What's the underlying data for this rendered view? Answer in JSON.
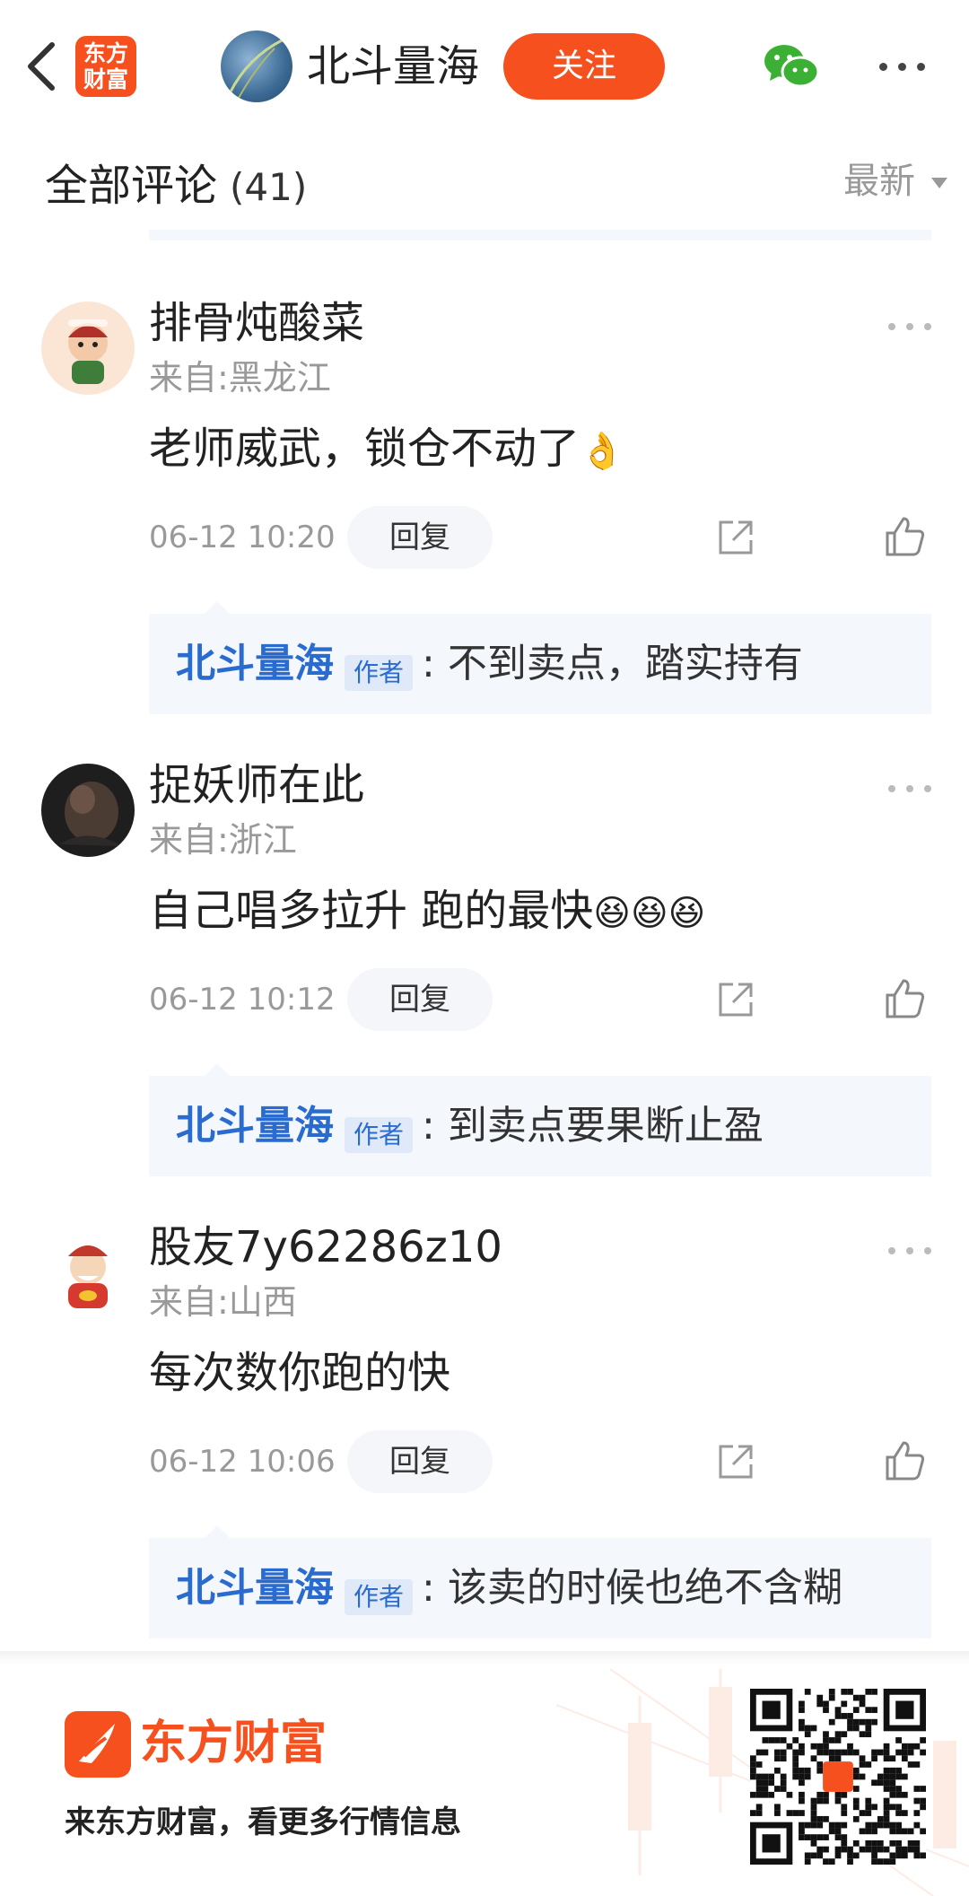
{
  "topbar": {
    "app_logo_text": "东方\n财富",
    "author_name": "北斗量海",
    "follow_label": "关注"
  },
  "section": {
    "title": "全部评论",
    "count": "(41)",
    "sort_label": "最新"
  },
  "comments": [
    {
      "name": "排骨炖酸菜",
      "location": "来自:黑龙江",
      "text": "老师威武，锁仓不动了",
      "emoji": "👌",
      "time": "06-12 10:20",
      "reply_label": "回复",
      "reply": {
        "author": "北斗量海",
        "tag": "作者",
        "text": ": 不到卖点，踏实持有"
      }
    },
    {
      "name": "捉妖师在此",
      "location": "来自:浙江",
      "text": "自己唱多拉升 跑的最快",
      "emoji": "😆😆😆",
      "time": "06-12 10:12",
      "reply_label": "回复",
      "reply": {
        "author": "北斗量海",
        "tag": "作者",
        "text": ": 到卖点要果断止盈"
      }
    },
    {
      "name": "股友7y62286z10",
      "location": "来自:山西",
      "text": "每次数你跑的快",
      "emoji": "",
      "time": "06-12 10:06",
      "reply_label": "回复",
      "reply": {
        "author": "北斗量海",
        "tag": "作者",
        "text": ": 该卖的时候也绝不含糊"
      }
    }
  ],
  "footer": {
    "brand": "东方财富",
    "slogan": "来东方财富，看更多行情信息"
  },
  "colors": {
    "accent": "#f5501e",
    "link_blue": "#2a6bd0"
  }
}
